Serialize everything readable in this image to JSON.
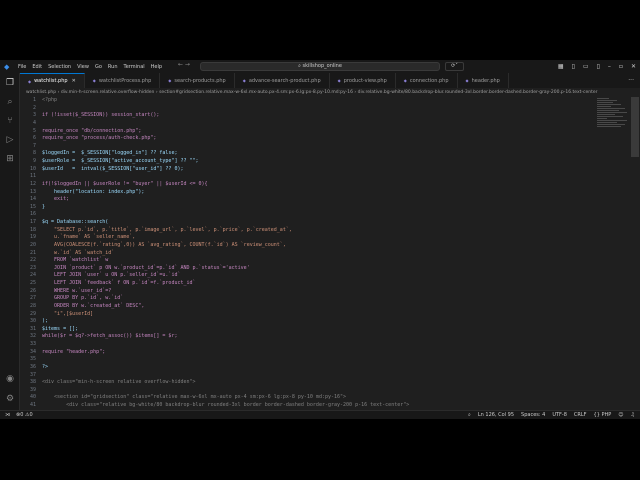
{
  "titlebar": {
    "menu": [
      "File",
      "Edit",
      "Selection",
      "View",
      "Go",
      "Run",
      "Terminal",
      "Help"
    ],
    "search": "skillshop_online"
  },
  "tabs": [
    "watchlist.php",
    "watchlistProcess.php",
    "search-products.php",
    "advance-search-product.php",
    "product-view.php",
    "connection.php",
    "header.php"
  ],
  "breadcrumb": [
    "watchlist.php",
    "div.min-h-screen.relative.overflow-hidden",
    "section#gridsection.relative.max-w-6xl.mx-auto.px-4.sm:px-6.lg:px-8.py-10.md:py-16",
    "div.relative.bg-white/80.backdrop-blur.rounded-3xl.border.border-dashed.border-gray-200.p-16.text-center"
  ],
  "code": [
    "<?php",
    "",
    "if (!isset($_SESSION)) session_start();",
    "",
    "require_once \"db/connection.php\";",
    "require_once \"process/auth-check.php\";",
    "",
    "$loggedIn =  $_SESSION[\"logged_in\"] ?? false;",
    "$userRole =  $_SESSION[\"active_account_type\"] ?? \"\";",
    "$userId   =  intval($_SESSION[\"user_id\"] ?? 0);",
    "",
    "if(!$loggedIn || $userRole != \"buyer\" || $userId <= 0){",
    "    header(\"location: index.php\");",
    "    exit;",
    "}",
    "",
    "$q = Database::search(",
    "    \"SELECT p.`id`, p.`title`, p.`image_url`, p.`level`, p.`price`, p.`created_at`,",
    "    u.`fname` AS `seller_name`,",
    "    AVG(COALESCE(f.`rating`,0)) AS `avg_rating`, COUNT(f.`id`) AS `review_count`,",
    "    w.`id` AS `watch_id`",
    "    FROM `watchlist` w",
    "    JOIN `product` p ON w.`product_id`=p.`id` AND p.`status`='active'",
    "    LEFT JOIN `user` u ON p.`seller_id`=u.`id`",
    "    LEFT JOIN `feedback` f ON p.`id`=f.`product_id`",
    "    WHERE w.`user_id`=?",
    "    GROUP BY p.`id`, w.`id`",
    "    ORDER BY w.`created_at` DESC\",",
    "    \"i\",[$userId]",
    ");",
    "$items = [];",
    "while($r = $q?->fetch_assoc()) $items[] = $r;",
    "",
    "require \"header.php\";",
    "",
    "?>",
    "",
    "<div class=\"min-h-screen relative overflow-hidden\">",
    "",
    "    <section id=\"gridsection\" class=\"relative max-w-6xl mx-auto px-4 sm:px-6 lg:px-8 py-10 md:py-16\">",
    "        <div class=\"relative bg-white/80 backdrop-blur rounded-3xl border border-dashed border-gray-200 p-16 text-center\">"
  ],
  "status": {
    "errors": "0",
    "warnings": "0",
    "position": "Ln 126, Col 95",
    "spaces": "Spaces: 4",
    "encoding": "UTF-8",
    "eol": "CRLF",
    "language": "PHP"
  }
}
